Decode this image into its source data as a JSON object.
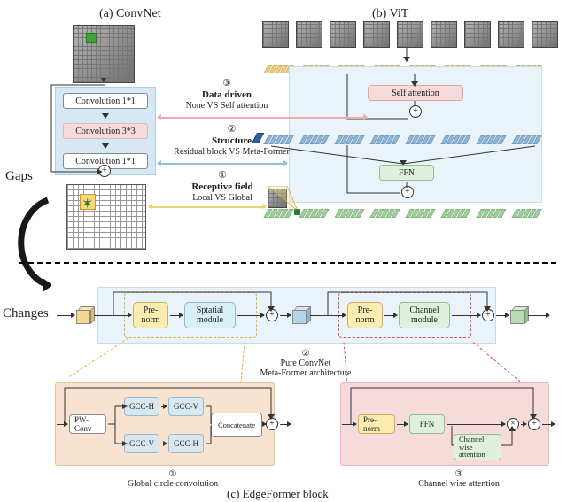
{
  "titles": {
    "a": "(a)  ConvNet",
    "b": "(b) ViT",
    "c": "(c) EdgeFormer block"
  },
  "sideLabels": {
    "gaps": "Gaps",
    "changes": "Changes"
  },
  "convStack": {
    "box1": "Convolution 1*1",
    "box2": "Convolution 3*3",
    "box3": "Convolution 1*1"
  },
  "vit": {
    "selfAttn": "Self attention",
    "ffn": "FFN"
  },
  "gaps": {
    "g3": {
      "num": "③",
      "title": "Data driven",
      "sub": "None VS Self attention"
    },
    "g2": {
      "num": "②",
      "title": "Structure",
      "sub": "Residual block VS Meta-Former"
    },
    "g1": {
      "num": "①",
      "title": "Receptive field",
      "sub": "Local VS Global"
    }
  },
  "pipeline": {
    "prenormA": "Pre-norm",
    "spatial": "Sptatial module",
    "prenormB": "Pre-norm",
    "channel": "Channel module"
  },
  "midNote": {
    "num": "②",
    "line1": "Pure ConvNet",
    "line2": "Meta-Former architecture"
  },
  "gccPanel": {
    "pw": "PW-Conv",
    "gccH": "GCC-H",
    "gccV": "GCC-V",
    "concat": "Concatenate",
    "caption_num": "①",
    "caption": "Global circle convolution"
  },
  "chPanel": {
    "prenorm": "Pre-norm",
    "ffn": "FFN",
    "cwa": "Channel wise attention",
    "caption_num": "③",
    "caption": "Channel wise attention"
  }
}
